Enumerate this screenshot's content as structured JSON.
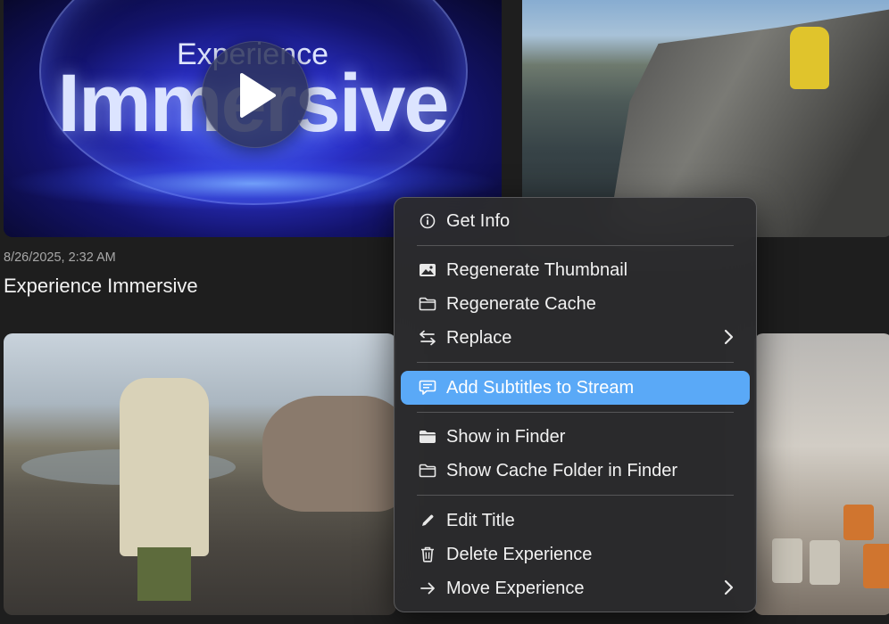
{
  "gallery": {
    "card1": {
      "brand_top": "Experience",
      "brand_main": "Immersive",
      "date": "8/26/2025, 2:32 AM",
      "title": "Experience Immersive"
    }
  },
  "context_menu": {
    "items": [
      {
        "label": "Get Info",
        "icon": "info-circle-icon"
      },
      {
        "label": "Regenerate Thumbnail",
        "icon": "photo-icon"
      },
      {
        "label": "Regenerate Cache",
        "icon": "folder-outline-icon"
      },
      {
        "label": "Replace",
        "icon": "swap-arrows-icon",
        "submenu": true
      },
      {
        "label": "Add Subtitles to Stream",
        "icon": "speech-bubble-icon",
        "highlighted": true
      },
      {
        "label": "Show in Finder",
        "icon": "folder-filled-icon"
      },
      {
        "label": "Show Cache Folder in Finder",
        "icon": "folder-outline-icon"
      },
      {
        "label": "Edit Title",
        "icon": "pencil-icon"
      },
      {
        "label": "Delete Experience",
        "icon": "trash-icon"
      },
      {
        "label": "Move Experience",
        "icon": "arrow-right-icon",
        "submenu": true
      }
    ],
    "highlight_color": "#5aa9f7"
  }
}
